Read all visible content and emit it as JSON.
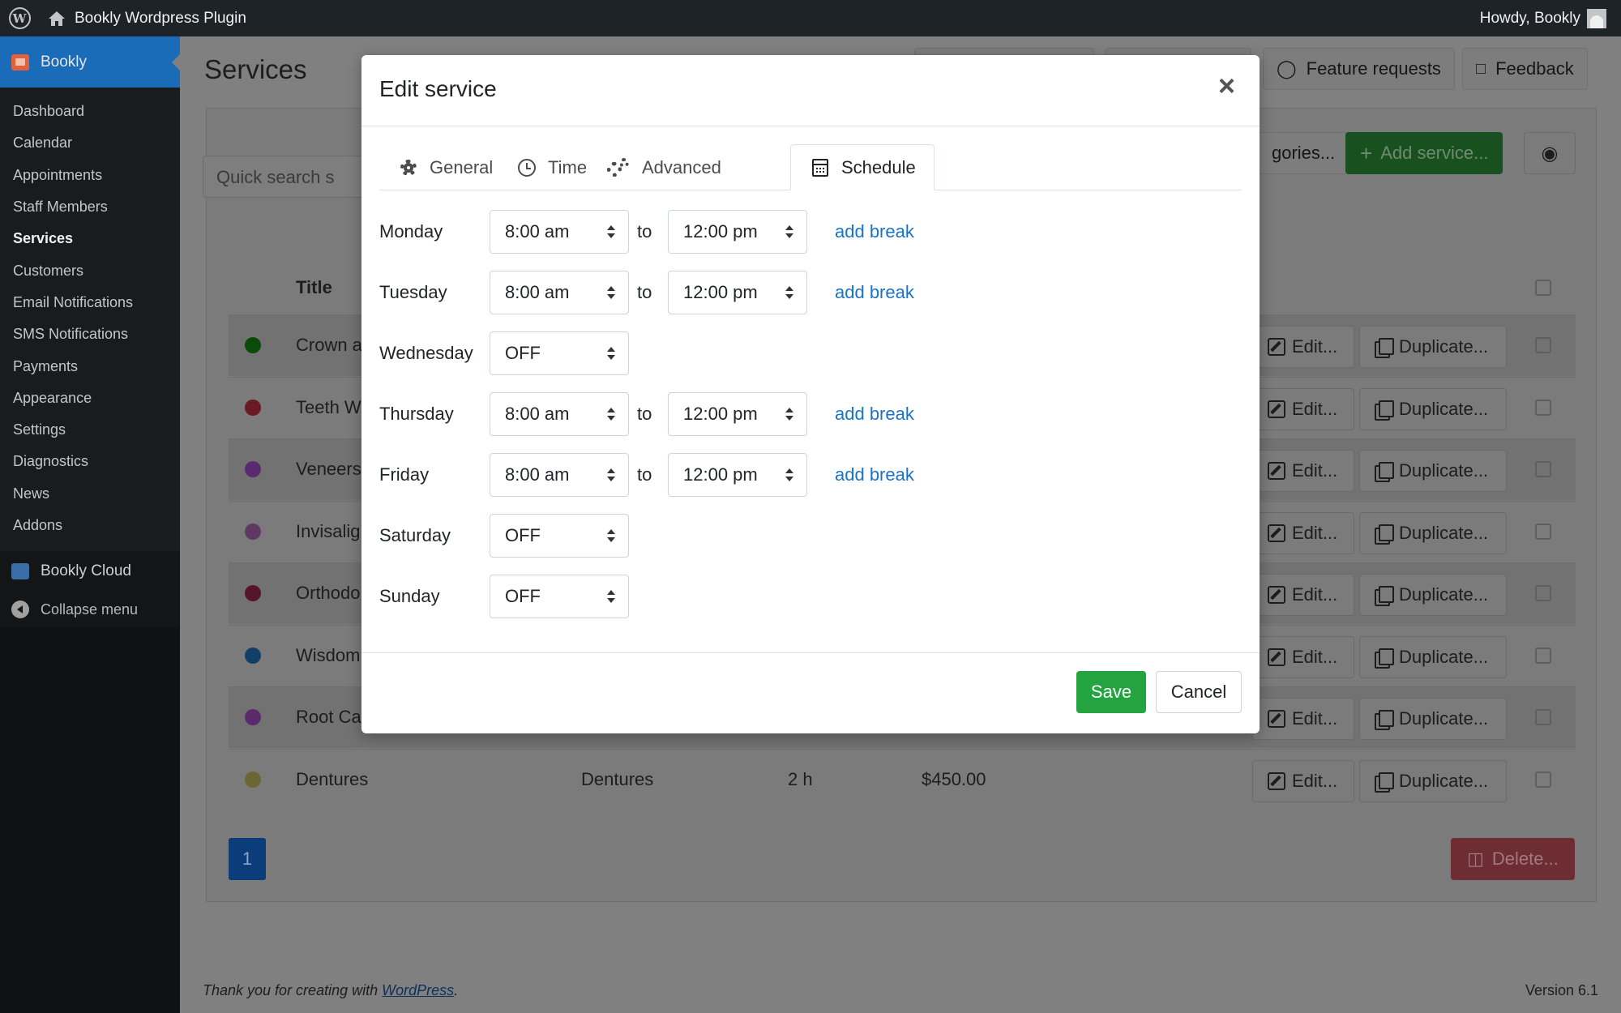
{
  "adminbar": {
    "site_name": "Bookly Wordpress Plugin",
    "howdy": "Howdy, Bookly"
  },
  "sidebar": {
    "plugin_title": "Bookly",
    "items": [
      {
        "label": "Dashboard"
      },
      {
        "label": "Calendar"
      },
      {
        "label": "Appointments"
      },
      {
        "label": "Staff Members"
      },
      {
        "label": "Services",
        "active": true
      },
      {
        "label": "Customers"
      },
      {
        "label": "Email Notifications"
      },
      {
        "label": "SMS Notifications"
      },
      {
        "label": "Payments"
      },
      {
        "label": "Appearance"
      },
      {
        "label": "Settings"
      },
      {
        "label": "Diagnostics"
      },
      {
        "label": "News"
      },
      {
        "label": "Addons"
      }
    ],
    "cloud_label": "Bookly Cloud",
    "collapse_label": "Collapse menu"
  },
  "page": {
    "title": "Services",
    "feature_requests": "Feature requests",
    "feedback": "Feedback",
    "categories_btn_partial": "gories...",
    "add_service": "Add service...",
    "search_placeholder_partial": "Quick search s",
    "col_title": "Title",
    "rows": [
      {
        "name": "Crown a",
        "color": "#0b4a0b"
      },
      {
        "name": "Teeth W",
        "color": "#6a1a25"
      },
      {
        "name": "Veneers",
        "color": "#5a2a6e"
      },
      {
        "name": "Invisalig",
        "color": "#5e3a63"
      },
      {
        "name": "Orthodo",
        "color": "#541529"
      },
      {
        "name": "Wisdom",
        "color": "#123f66"
      },
      {
        "name": "Root Ca",
        "color": "#5a2a6a"
      },
      {
        "name": "Dentures",
        "category": "Dentures",
        "duration": "2 h",
        "price": "$450.00",
        "color": "#6c6635"
      }
    ],
    "edit_label": "Edit...",
    "duplicate_label": "Duplicate...",
    "page_number": "1",
    "delete_label": "Delete...",
    "footer_text": "Thank you for creating with",
    "footer_link": "WordPress",
    "version": "Version 6.1"
  },
  "modal": {
    "title": "Edit service",
    "close": "×",
    "tabs": [
      {
        "label": "General",
        "icon": "gear-icon"
      },
      {
        "label": "Time",
        "icon": "clock-icon"
      },
      {
        "label": "Advanced",
        "icon": "gears-icon"
      },
      {
        "label": "Schedule",
        "icon": "calendar-icon",
        "active": true
      }
    ],
    "to_label": "to",
    "add_break_label": "add break",
    "schedule": [
      {
        "day": "Monday",
        "start": "8:00 am",
        "end": "12:00 pm"
      },
      {
        "day": "Tuesday",
        "start": "8:00 am",
        "end": "12:00 pm"
      },
      {
        "day": "Wednesday",
        "start": "OFF"
      },
      {
        "day": "Thursday",
        "start": "8:00 am",
        "end": "12:00 pm"
      },
      {
        "day": "Friday",
        "start": "8:00 am",
        "end": "12:00 pm"
      },
      {
        "day": "Saturday",
        "start": "OFF"
      },
      {
        "day": "Sunday",
        "start": "OFF"
      }
    ],
    "save": "Save",
    "cancel": "Cancel"
  }
}
